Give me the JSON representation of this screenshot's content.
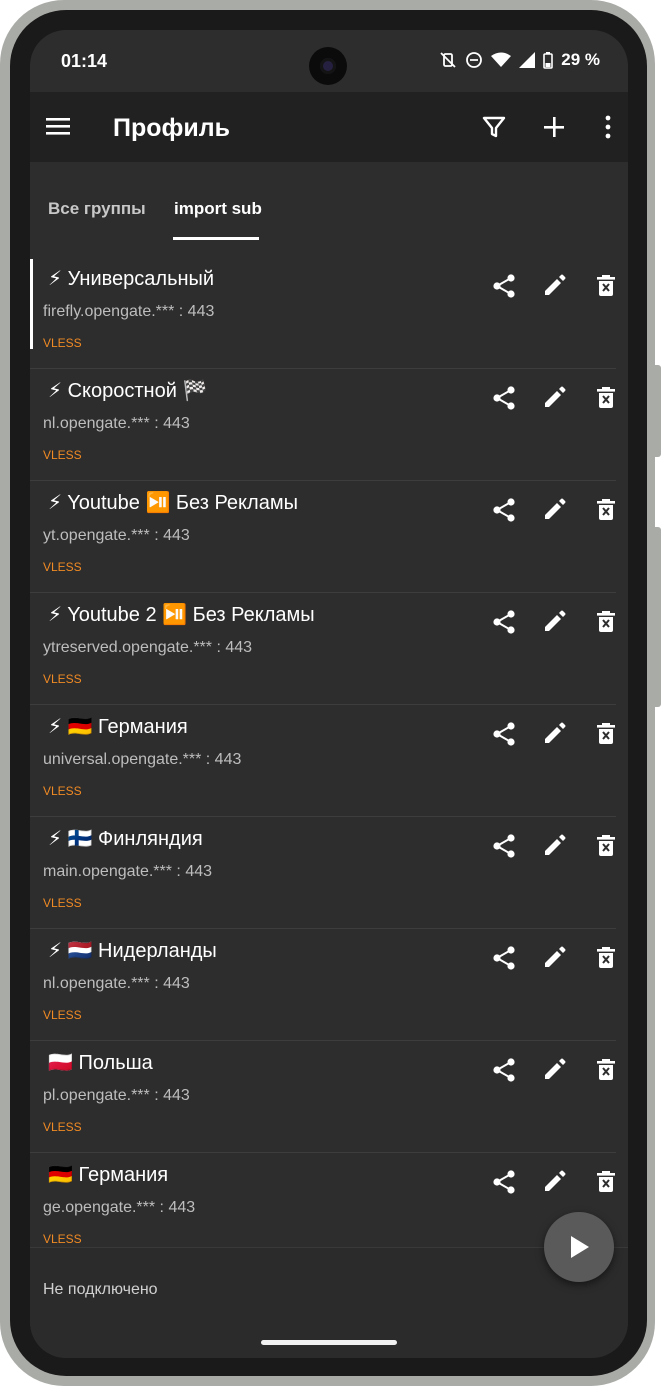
{
  "status_bar": {
    "time": "01:14",
    "battery": "29 %"
  },
  "app_bar": {
    "title": "Профиль",
    "icons": [
      "menu-icon",
      "filter-icon",
      "add-icon",
      "more-vert-icon"
    ]
  },
  "tabs": [
    {
      "label": "Все группы",
      "active": false
    },
    {
      "label": "import sub",
      "active": true
    }
  ],
  "servers": [
    {
      "name": "⚡  Универсальный",
      "address": "firefly.opengate.*** : 443",
      "protocol": "VLESS",
      "selected": true
    },
    {
      "name": "⚡ Скоростной 🏁",
      "address": "nl.opengate.*** : 443",
      "protocol": "VLESS",
      "selected": false
    },
    {
      "name": "⚡ Youtube ⏯️ Без Рекламы",
      "address": "yt.opengate.*** : 443",
      "protocol": "VLESS",
      "selected": false
    },
    {
      "name": "⚡ Youtube 2 ⏯️ Без Рекламы",
      "address": "ytreserved.opengate.*** : 443",
      "protocol": "VLESS",
      "selected": false
    },
    {
      "name": "⚡ 🇩🇪 Германия",
      "address": "universal.opengate.*** : 443",
      "protocol": "VLESS",
      "selected": false
    },
    {
      "name": "⚡ 🇫🇮 Финляндия",
      "address": "main.opengate.*** : 443",
      "protocol": "VLESS",
      "selected": false
    },
    {
      "name": "⚡ 🇳🇱 Нидерланды",
      "address": "nl.opengate.*** : 443",
      "protocol": "VLESS",
      "selected": false
    },
    {
      "name": "🇵🇱 Польша",
      "address": "pl.opengate.*** : 443",
      "protocol": "VLESS",
      "selected": false
    },
    {
      "name": "🇩🇪 Германия",
      "address": "ge.opengate.*** : 443",
      "protocol": "VLESS",
      "selected": false
    }
  ],
  "item_actions": [
    "share-icon",
    "edit-icon",
    "delete-icon"
  ],
  "connection_status": "Не подключено",
  "colors": {
    "background": "#2d2d2d",
    "app_bar": "#212121",
    "protocol": "#f08a24",
    "text": "#ffffff"
  }
}
